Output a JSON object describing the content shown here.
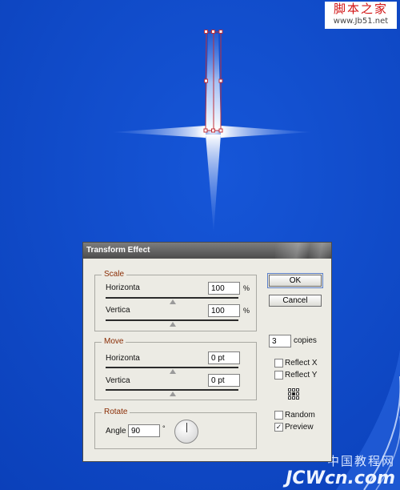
{
  "watermarks": {
    "top_line1": "脚本之家",
    "top_line2": "www.Jb51.net",
    "bottom_cn": "中国教程网",
    "bottom_en": "JCWcn.com"
  },
  "colors": {
    "canvas_bg": "#0a47c9",
    "path_stroke": "#c0303a",
    "legend_text": "#8a2d05"
  },
  "dialog": {
    "title": "Transform Effect",
    "scale": {
      "legend": "Scale",
      "horizontal_label": "Horizonta",
      "horizontal_value": "100",
      "horizontal_unit": "%",
      "vertical_label": "Vertica",
      "vertical_value": "100",
      "vertical_unit": "%"
    },
    "move": {
      "legend": "Move",
      "horizontal_label": "Horizonta",
      "horizontal_value": "0 pt",
      "vertical_label": "Vertica",
      "vertical_value": "0 pt"
    },
    "rotate": {
      "legend": "Rotate",
      "angle_label": "Angle",
      "angle_value": "90",
      "angle_unit": "°"
    },
    "buttons": {
      "ok": "OK",
      "cancel": "Cancel"
    },
    "copies": {
      "value": "3",
      "label": "copies"
    },
    "options": {
      "reflect_x": {
        "label": "Reflect X",
        "checked": false
      },
      "reflect_y": {
        "label": "Reflect Y",
        "checked": false
      },
      "random": {
        "label": "Random",
        "checked": false
      },
      "preview": {
        "label": "Preview",
        "checked": true
      }
    },
    "reference_point_icon": "reference-point-grid-icon",
    "angle_dial_icon": "angle-dial-icon"
  }
}
